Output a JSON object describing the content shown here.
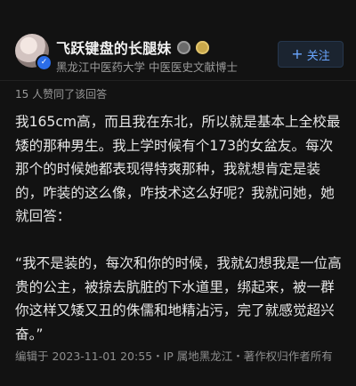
{
  "author": {
    "name": "飞跃键盘的长腿妹",
    "subtitle": "黑龙江中医药大学 中医医史文献博士",
    "follow_label": "关注"
  },
  "likes_text": "15 人赞同了该回答",
  "content": {
    "paragraphs": [
      "我165cm高，而且我在东北，所以就是基本上全校最矮的那种男生。我上学时候有个173的女盆友。每次那个的时候她都表现得特爽那种，我就想肯定是装的，咋装的这么像，咋技术这么好呢？我就问她，她就回答：",
      "“我不是装的，每次和你的时候，我就幻想我是一位高贵的公主，被掠去肮脏的下水道里，绑起来，被一群你这样又矮又丑的侏儒和地精沾污，完了就感觉超兴奋。”"
    ]
  },
  "footer_text": "编辑于 2023-11-01 20:55・IP 属地黑龙江・著作权归作者所有"
}
